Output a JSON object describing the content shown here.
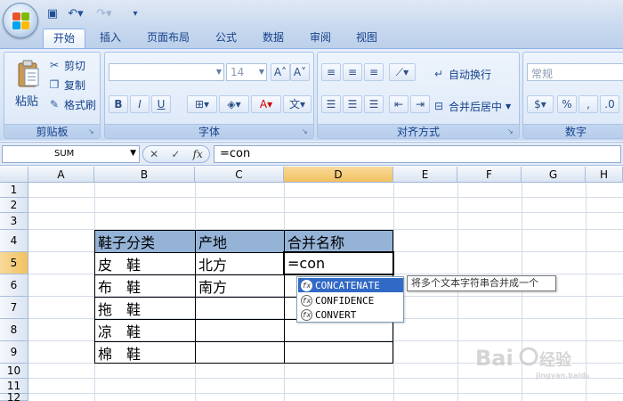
{
  "quick_access": {
    "save_icon": "save-icon",
    "undo_icon": "undo-icon",
    "redo_icon": "redo-icon"
  },
  "tabs": [
    {
      "label": "开始",
      "active": true
    },
    {
      "label": "插入"
    },
    {
      "label": "页面布局"
    },
    {
      "label": "公式"
    },
    {
      "label": "数据"
    },
    {
      "label": "审阅"
    },
    {
      "label": "视图"
    }
  ],
  "ribbon": {
    "clipboard": {
      "label": "剪贴板",
      "paste": "粘贴",
      "cut": "剪切",
      "copy": "复制",
      "format_painter": "格式刷"
    },
    "font": {
      "label": "字体",
      "size": "14",
      "bold": "B",
      "italic": "I",
      "underline": "U"
    },
    "alignment": {
      "label": "对齐方式",
      "wrap_text": "自动换行",
      "merge_center": "合并后居中"
    },
    "number": {
      "label": "数字",
      "format": "常规"
    }
  },
  "formula_bar": {
    "name_box": "SUM",
    "fx": "fx",
    "formula": "=con"
  },
  "columns": [
    "A",
    "B",
    "C",
    "D",
    "E",
    "F",
    "G",
    "H"
  ],
  "rows": [
    "1",
    "2",
    "3",
    "4",
    "5",
    "6",
    "7",
    "8",
    "9",
    "10",
    "11",
    "12"
  ],
  "table": {
    "headers": [
      "鞋子分类",
      "产地",
      "合并名称"
    ],
    "col_b": [
      "皮　鞋",
      "布　鞋",
      "拖　鞋",
      "凉　鞋",
      "棉　鞋"
    ],
    "col_c": [
      "北方",
      "南方",
      "",
      "",
      ""
    ],
    "editing_value": "=con"
  },
  "autocomplete": {
    "items": [
      "CONCATENATE",
      "CONFIDENCE",
      "CONVERT"
    ],
    "tooltip": "将多个文本字符串合并成一个"
  },
  "colors": {
    "header_fill": "#95b3d7",
    "selection": "#3169c6",
    "active_header": "#f1c15f"
  }
}
